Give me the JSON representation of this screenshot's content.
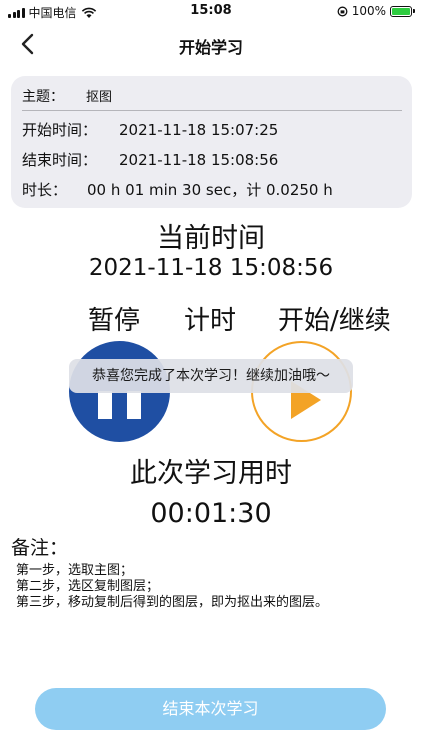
{
  "status_bar": {
    "carrier": "中国电信",
    "time": "15:08",
    "battery_percent": "100%",
    "signal_icon": "signal-bars-icon",
    "wifi_icon": "wifi-icon",
    "battery_icon": "battery-charging-icon"
  },
  "nav": {
    "back_icon": "chevron-left-icon",
    "title": "开始学习"
  },
  "info": {
    "subject_label": "主题：",
    "subject_value": "抠图",
    "start_label": "开始时间：",
    "start_value": "2021-11-18 15:07:25",
    "end_label": "结束时间：",
    "end_value": "2021-11-18 15:08:56",
    "duration_label": "时长：",
    "duration_value": "00 h 01 min 30 sec，计 0.0250 h"
  },
  "current": {
    "title": "当前时间",
    "time": "2021-11-18 15:08:56"
  },
  "controls": {
    "pause_label": "暂停",
    "timing_label": "计时",
    "start_label": "开始/继续",
    "pause_icon": "pause-icon",
    "play_icon": "play-icon",
    "pause_color": "#1f4fa3",
    "play_color": "#f3a326"
  },
  "toast": {
    "message": "恭喜您完成了本次学习！继续加油哦～"
  },
  "study": {
    "title": "此次学习用时",
    "elapsed": "00:01:30"
  },
  "notes": {
    "title": "备注：",
    "lines": [
      "第一步，选取主图；",
      "第二步，选区复制图层；",
      "第三步，移动复制后得到的图层，即为抠出来的图层。"
    ]
  },
  "actions": {
    "end_label": "结束本次学习",
    "end_color": "#8fcdf2"
  }
}
